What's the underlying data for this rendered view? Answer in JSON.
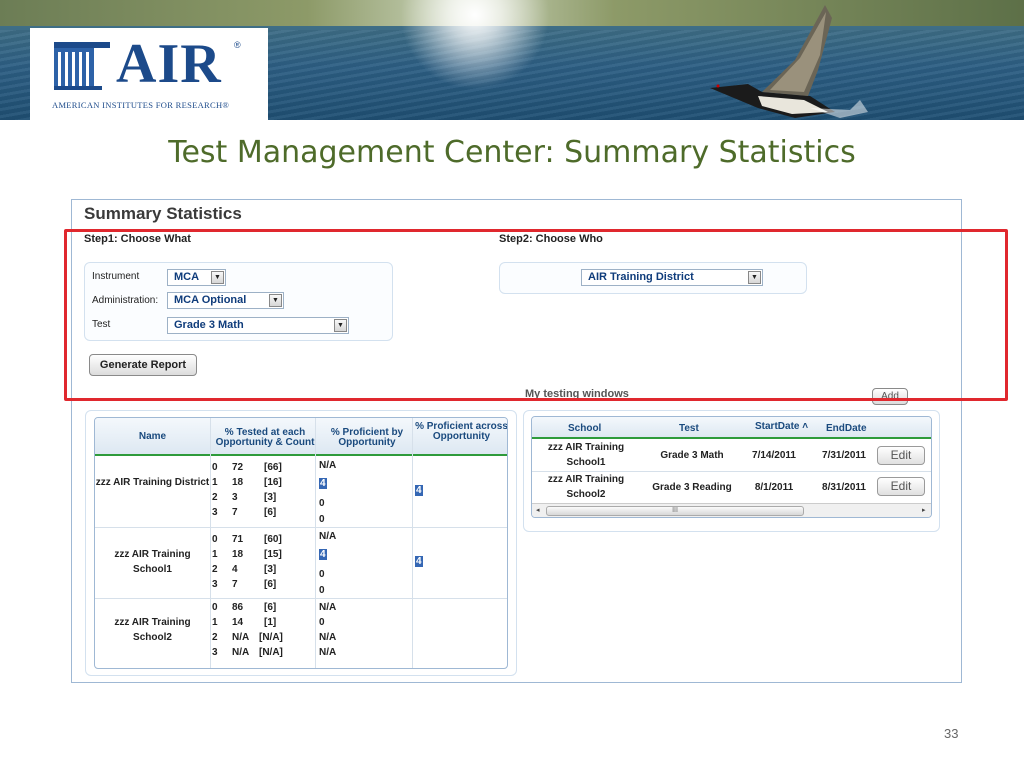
{
  "logo": {
    "wordmark": "AIR",
    "registered": "®",
    "tagline": "American Institutes for Research®"
  },
  "slide_title": "Test Management Center: Summary Statistics",
  "panel": {
    "heading": "Summary Statistics",
    "step1_label": "Step1: Choose What",
    "step2_label": "Step2: Choose Who",
    "instrument_label": "Instrument",
    "instrument_value": "MCA",
    "administration_label": "Administration:",
    "administration_value": "MCA Optional",
    "test_label": "Test",
    "test_value": "Grade 3 Math",
    "who_value": "AIR Training District",
    "generate_button": "Generate Report",
    "windows_label": "My testing windows",
    "add_button": "Add"
  },
  "results": {
    "headers": {
      "name": "Name",
      "tested": "% Tested at each Opportunity & Count",
      "proficient": "% Proficient by Opportunity",
      "across": "% Proficient across Opportunity"
    },
    "rows": [
      {
        "name": "zzz AIR Training District",
        "lines": [
          {
            "opp": "0",
            "pct": "72",
            "count": "[66]",
            "prof": "N/A"
          },
          {
            "opp": "1",
            "pct": "18",
            "count": "[16]",
            "prof": "4"
          },
          {
            "opp": "2",
            "pct": "3",
            "count": "[3]",
            "prof": "0"
          },
          {
            "opp": "3",
            "pct": "7",
            "count": "[6]",
            "prof": "0"
          }
        ],
        "across": "4"
      },
      {
        "name": "zzz AIR Training School1",
        "lines": [
          {
            "opp": "0",
            "pct": "71",
            "count": "[60]",
            "prof": "N/A"
          },
          {
            "opp": "1",
            "pct": "18",
            "count": "[15]",
            "prof": "4"
          },
          {
            "opp": "2",
            "pct": "4",
            "count": "[3]",
            "prof": "0"
          },
          {
            "opp": "3",
            "pct": "7",
            "count": "[6]",
            "prof": "0"
          }
        ],
        "across": "4"
      },
      {
        "name": "zzz AIR Training School2",
        "lines": [
          {
            "opp": "0",
            "pct": "86",
            "count": "[6]",
            "prof": "N/A"
          },
          {
            "opp": "1",
            "pct": "14",
            "count": "[1]",
            "prof": "0"
          },
          {
            "opp": "2",
            "pct": "N/A",
            "count": "[N/A]",
            "prof": "N/A"
          },
          {
            "opp": "3",
            "pct": "N/A",
            "count": "[N/A]",
            "prof": "N/A"
          }
        ],
        "across": ""
      }
    ]
  },
  "windows": {
    "headers": {
      "school": "School",
      "test": "Test",
      "start": "StartDate",
      "sort_icon": "˄",
      "end": "EndDate"
    },
    "rows": [
      {
        "school": "zzz AIR Training School1",
        "test": "Grade 3 Math",
        "start": "7/14/2011",
        "end": "7/31/2011",
        "edit": "Edit"
      },
      {
        "school": "zzz AIR Training School2",
        "test": "Grade 3 Reading",
        "start": "8/1/2011",
        "end": "8/31/2011",
        "edit": "Edit"
      }
    ],
    "scroll_grip": "III",
    "scroll_left": "◂",
    "scroll_right": "▸"
  },
  "dropdown_arrow": "▼",
  "page_number": "33",
  "colors": {
    "title_green": "#4e6b2a",
    "highlight_red": "#e0282e",
    "header_blue": "#1a4a7e",
    "header_rule_green": "#2e9b3b",
    "logo_blue": "#1c4a8a"
  }
}
